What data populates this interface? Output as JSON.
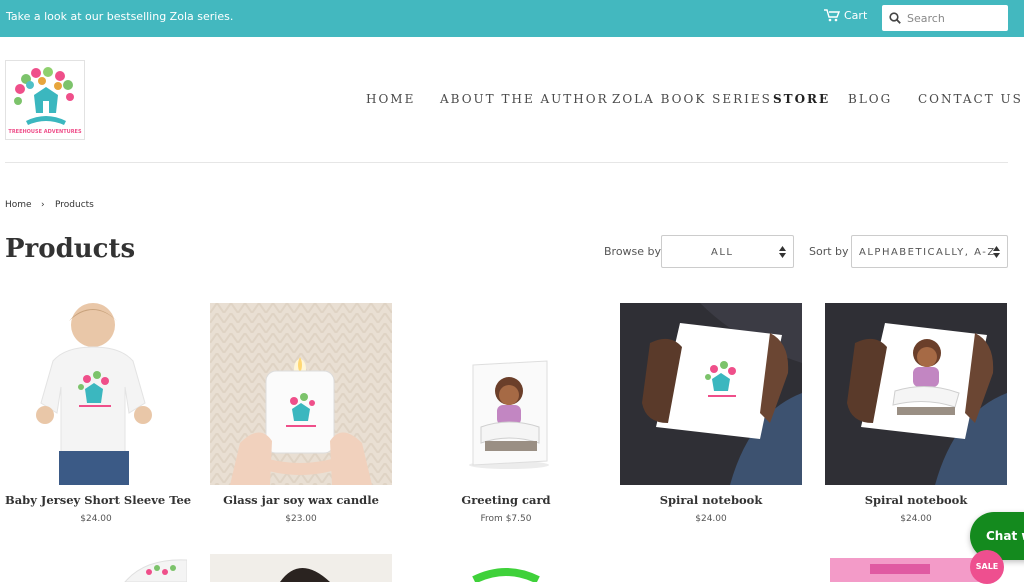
{
  "announcement": "Take a look at our bestselling Zola series.",
  "header": {
    "cart_label": "Cart",
    "search_placeholder": "Search",
    "logo_text": "TREEHOUSE ADVENTURES",
    "nav": [
      "HOME",
      "ABOUT THE AUTHOR",
      "ZOLA BOOK SERIES",
      "STORE",
      "BLOG",
      "CONTACT US"
    ],
    "active_nav": "STORE"
  },
  "breadcrumb": {
    "home": "Home",
    "separator": "›",
    "current": "Products"
  },
  "page_title": "Products",
  "filters": {
    "browse_label": "Browse by",
    "browse_value": "ALL",
    "sort_label": "Sort by",
    "sort_value": "ALPHABETICALLY, A-Z"
  },
  "products": [
    {
      "name": "Baby Jersey Short Sleeve Tee",
      "price": "$24.00"
    },
    {
      "name": "Glass jar soy wax candle",
      "price": "$23.00"
    },
    {
      "name": "Greeting card",
      "price": "From $7.50"
    },
    {
      "name": "Spiral notebook",
      "price": "$24.00"
    },
    {
      "name": "Spiral notebook",
      "price": "$24.00"
    }
  ],
  "widgets": {
    "chat_label": "Chat w",
    "sale_badge": "SALE"
  },
  "colors": {
    "announcement_bg": "#43b8bf",
    "chat_bg": "#148a1e",
    "sale_bg": "#ee4f8f"
  }
}
